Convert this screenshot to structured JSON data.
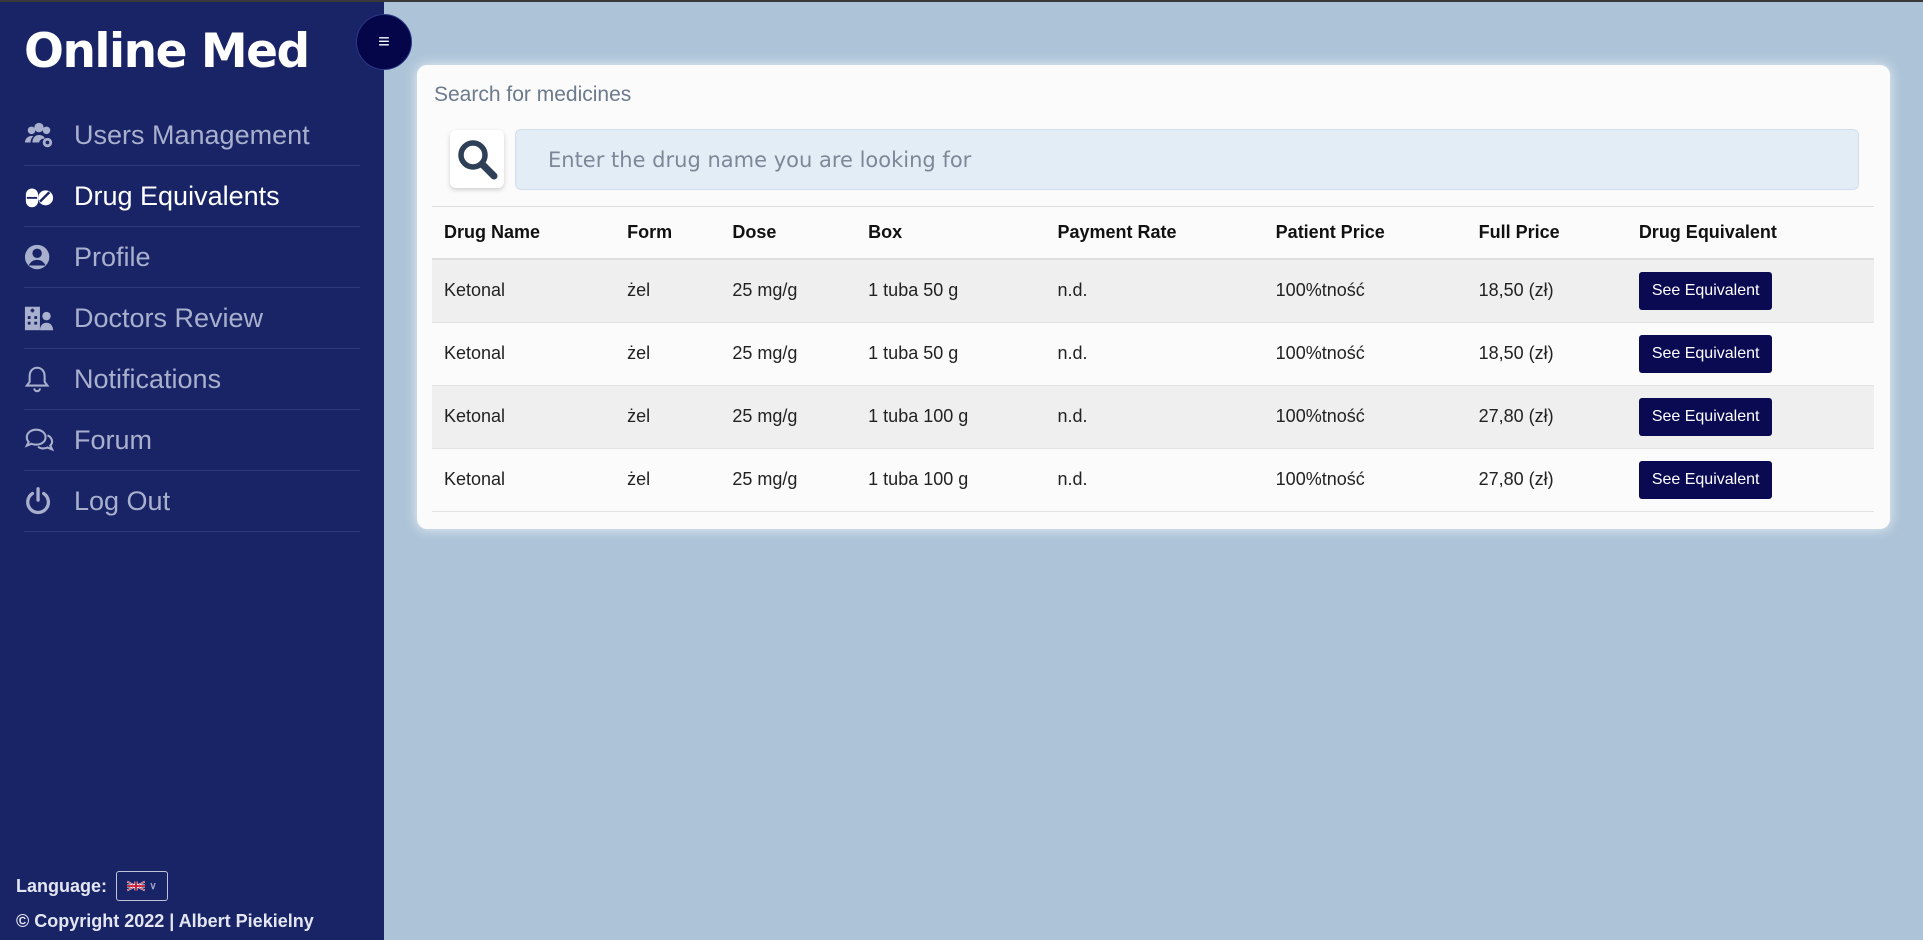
{
  "app": {
    "brand": "Online Med",
    "toggle_glyph": "≡"
  },
  "sidebar": {
    "items": [
      {
        "label": "Users Management",
        "icon": "users-cog-icon",
        "active": false
      },
      {
        "label": "Drug Equivalents",
        "icon": "pills-icon",
        "active": true
      },
      {
        "label": "Profile",
        "icon": "user-circle-icon",
        "active": false
      },
      {
        "label": "Doctors Review",
        "icon": "hospital-user-icon",
        "active": false
      },
      {
        "label": "Notifications",
        "icon": "bell-icon",
        "active": false
      },
      {
        "label": "Forum",
        "icon": "comments-icon",
        "active": false
      },
      {
        "label": "Log Out",
        "icon": "power-icon",
        "active": false
      }
    ],
    "language_label": "Language:",
    "language_selected": "en-GB",
    "copyright": "© Copyright 2022 | Albert Piekielny"
  },
  "search": {
    "title": "Search for medicines",
    "placeholder": "Enter the drug name you are looking for",
    "value": ""
  },
  "table": {
    "headers": [
      "Drug Name",
      "Form",
      "Dose",
      "Box",
      "Payment Rate",
      "Patient Price",
      "Full Price",
      "Drug Equivalent"
    ],
    "rows": [
      [
        "Ketonal",
        "żel",
        "25 mg/g",
        "1 tuba 50 g",
        "n.d.",
        "100%tność",
        "18,50 (zł)",
        "See Equivalent"
      ],
      [
        "Ketonal",
        "żel",
        "25 mg/g",
        "1 tuba 50 g",
        "n.d.",
        "100%tność",
        "18,50 (zł)",
        "See Equivalent"
      ],
      [
        "Ketonal",
        "żel",
        "25 mg/g",
        "1 tuba 100 g",
        "n.d.",
        "100%tność",
        "27,80 (zł)",
        "See Equivalent"
      ],
      [
        "Ketonal",
        "żel",
        "25 mg/g",
        "1 tuba 100 g",
        "n.d.",
        "100%tność",
        "27,80 (zł)",
        "See Equivalent"
      ]
    ]
  },
  "colors": {
    "sidebar_bg": "#192466",
    "page_bg": "#adc4d8",
    "button_bg": "#0a0a52",
    "toggle_bg": "#05054a"
  }
}
